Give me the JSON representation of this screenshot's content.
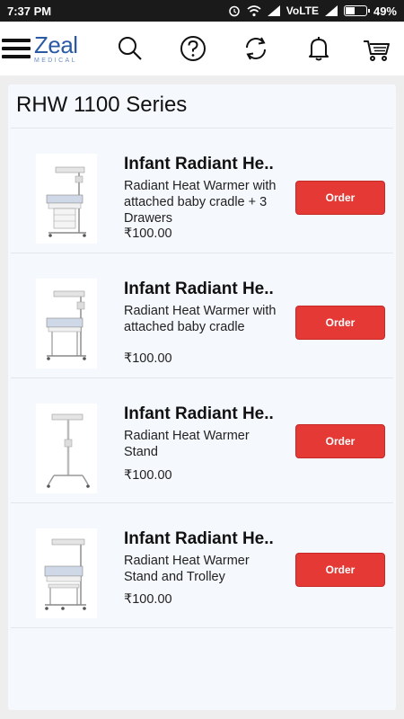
{
  "status_bar": {
    "time": "7:37 PM",
    "network": "VoLTE",
    "battery": "49%",
    "battery_level": 0.49
  },
  "header": {
    "logo_brand": "Zeal",
    "logo_sub": "MEDICAL",
    "icons": [
      "menu-icon",
      "search-icon",
      "help-icon",
      "refresh-icon",
      "bell-icon",
      "cart-icon"
    ]
  },
  "series": {
    "title": "RHW 1100 Series"
  },
  "products": [
    {
      "name": "Infant Radiant He..",
      "description": "Radiant Heat Warmer with attached baby cradle + 3 Drawers",
      "price": "₹100.00",
      "button": "Order"
    },
    {
      "name": "Infant Radiant He..",
      "description": "Radiant Heat Warmer with attached baby cradle",
      "price": "₹100.00",
      "button": "Order"
    },
    {
      "name": "Infant Radiant He..",
      "description": "Radiant Heat Warmer Stand",
      "price": "₹100.00",
      "button": "Order"
    },
    {
      "name": "Infant Radiant He..",
      "description": "Radiant Heat Warmer Stand and Trolley",
      "price": "₹100.00",
      "button": "Order"
    }
  ],
  "colors": {
    "order_button": "#e53935",
    "logo": "#2a5aa3",
    "card_bg": "#f5f8fc"
  }
}
